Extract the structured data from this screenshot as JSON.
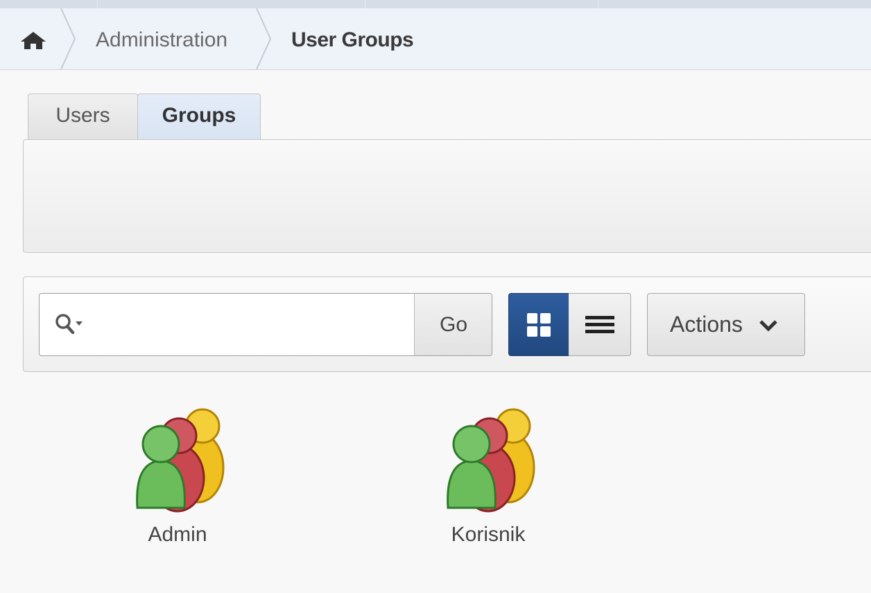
{
  "breadcrumb": {
    "home_icon": "home-icon",
    "items": [
      {
        "label": "Administration"
      },
      {
        "label": "User Groups"
      }
    ]
  },
  "tabs": [
    {
      "label": "Users",
      "active": false
    },
    {
      "label": "Groups",
      "active": true
    }
  ],
  "toolbar": {
    "search": {
      "value": "",
      "placeholder": "",
      "icon": "search-icon"
    },
    "go_label": "Go",
    "view_modes": [
      {
        "name": "icons-view",
        "active": true,
        "icon": "grid-icon"
      },
      {
        "name": "report-view",
        "active": false,
        "icon": "list-icon"
      }
    ],
    "actions_label": "Actions",
    "actions_icon": "chevron-down-icon"
  },
  "groups": [
    {
      "label": "Admin",
      "icon": "user-group-icon"
    },
    {
      "label": "Korisnik",
      "icon": "user-group-icon"
    }
  ],
  "colors": {
    "accent": "#2a5595",
    "breadcrumb_bg": "#eef2f9",
    "active_tab_bg": "#dde6f4",
    "person_green": "#6bbd5c",
    "person_red": "#c9474f",
    "person_yellow": "#f0c020"
  }
}
